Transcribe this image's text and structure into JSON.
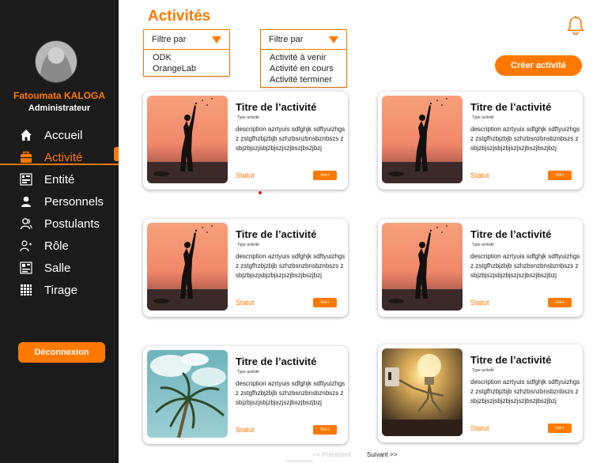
{
  "user": {
    "name": "Fatoumata KALOGA",
    "role": "Administrateur"
  },
  "nav": [
    {
      "label": "Accueil",
      "icon": "home-icon",
      "active": false
    },
    {
      "label": "Activité",
      "icon": "briefcase-icon",
      "active": true
    },
    {
      "label": "Entité",
      "icon": "building-icon",
      "active": false
    },
    {
      "label": "Personnels",
      "icon": "person-icon",
      "active": false
    },
    {
      "label": "Postulants",
      "icon": "users-icon",
      "active": false
    },
    {
      "label": "Rôle",
      "icon": "user-role-icon",
      "active": false
    },
    {
      "label": "Salle",
      "icon": "room-icon",
      "active": false
    },
    {
      "label": "Tirage",
      "icon": "grid-icon",
      "active": false
    }
  ],
  "logout_label": "Déconnexion",
  "page_title": "Activités",
  "filter1": {
    "label": "Filtre par",
    "options": [
      "ODK",
      "OrangeLab"
    ]
  },
  "filter2": {
    "label": "Filtre par",
    "options": [
      "Activité à venir",
      "Activité en cours",
      "Activité terminer"
    ]
  },
  "create_label": "Créer activité",
  "cards": [
    {
      "title": "Titre  de l’activité",
      "type": "Type activité",
      "description": "description azrtyuis sdfghjk sdftyuizhgsz zstgfhzbjzbjb szhzbsnzbnsbznbszs zsbjzbjszjsbjzbjszjszjbszjbszjbzj",
      "status": "Statut",
      "button": "Voir+",
      "image": "sunset-photo"
    },
    {
      "title": "Titre  de l’activité",
      "type": "Type activité",
      "description": "description azrtyuis sdfghjk sdftyuizhgsz zstgfhzbjzbjb szhzbsnzbnsbznbszs zsbjzbjszjsbjzbjszjszjbszjbszjbzj",
      "status": "Statut",
      "button": "Voir+",
      "image": "sunset-photo"
    },
    {
      "title": "Titre  de l’activité",
      "type": "Type activité",
      "description": "description azrtyuis sdfghjk sdftyuizhgsz zstgfhzbjzbjb szhzbsnzbnsbznbszs zsbjzbjszjsbjzbjszjszjbszjbszjbzj",
      "status": "Statut",
      "button": "Voir+",
      "image": "sunset-photo"
    },
    {
      "title": "Titre  de l’activité",
      "type": "Type activité",
      "description": "description azrtyuis sdfghjk sdftyuizhgsz zstgfhzbjzbjb szhzbsnzbnsbznbszs zsbjzbjszjsbjzbjszjszjbszjbszjbzj",
      "status": "Statut",
      "button": "Voir+",
      "image": "sunset-photo"
    },
    {
      "title": "Titre  de l’activité",
      "type": "Type activité",
      "description": "description azrtyuis sdfghjk sdftyuizhgsz zstgfhzbjzbjb szhzbsnzbnsbznbszs zsbjzbjszjsbjzbjszjszjbszjbszjbzj",
      "status": "Statut",
      "button": "Voir+",
      "image": "palm-photo"
    },
    {
      "title": "Titre  de l’activité",
      "type": "Type activité",
      "description": "description azrtyuis sdfghjk sdftyuizhgsz zstgfhzbjzbjb szhzbsnzbnsbznbszs zsbjzbjszjsbjzbjszjszjbszjbszjbzj",
      "status": "Statut",
      "button": "Voir+",
      "image": "lightbulb-photo"
    }
  ],
  "pagination": {
    "previous": "<< Précédent",
    "next": "Suivant >>"
  },
  "colors": {
    "accent": "#ff7900",
    "sidebar": "#1b1b1b"
  }
}
